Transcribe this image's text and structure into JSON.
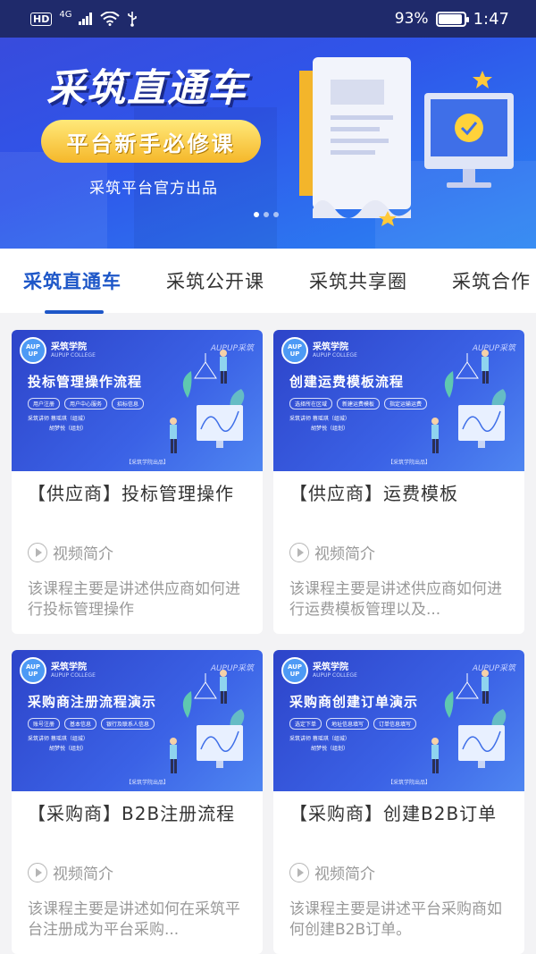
{
  "status_bar": {
    "network_left": "HD",
    "network_gen": "4G",
    "battery_percent": "93%",
    "battery_level": 0.93,
    "time": "1:47"
  },
  "banner": {
    "title": "采筑直通车",
    "subtitle": "平台新手必修课",
    "caption": "采筑平台官方出品",
    "page_count": 3,
    "active_page": 0
  },
  "tabs": [
    {
      "label": "采筑直通车",
      "active": true
    },
    {
      "label": "采筑公开课",
      "active": false
    },
    {
      "label": "采筑共享圈",
      "active": false
    },
    {
      "label": "采筑合作",
      "active": false
    }
  ],
  "thumb_common": {
    "logo": "AUP UP",
    "logo_cn": "采筑学院",
    "logo_en": "AUPUP COLLEGE",
    "brand": "AUPUP采筑",
    "lecturer": "采筑讲师  蔡瑶琪（组城）",
    "lecturer2": "胡梦悦（组划）",
    "footer": "【采筑学院出品】"
  },
  "cards": [
    {
      "thumb_title": "投标管理操作流程",
      "thumb_tags": [
        "用户注册",
        "用户中心服务",
        "招标信息"
      ],
      "title": "【供应商】投标管理操作",
      "meta": "视频简介",
      "desc": "该课程主要是讲述供应商如何进行投标管理操作"
    },
    {
      "thumb_title": "创建运费模板流程",
      "thumb_tags": [
        "选择所在区域",
        "新建运费模板",
        "指定运输运费"
      ],
      "title": "【供应商】运费模板",
      "meta": "视频简介",
      "desc": "该课程主要是讲述供应商如何进行运费模板管理以及..."
    },
    {
      "thumb_title": "采购商注册流程演示",
      "thumb_tags": [
        "账号注册",
        "基本信息",
        "银行及联系人信息"
      ],
      "title": "【采购商】B2B注册流程",
      "meta": "视频简介",
      "desc": "该课程主要是讲述如何在采筑平台注册成为平台采购..."
    },
    {
      "thumb_title": "采购商创建订单演示",
      "thumb_tags": [
        "选定下单",
        "地址信息填写",
        "订单信息填写"
      ],
      "title": "【采购商】创建B2B订单",
      "meta": "视频简介",
      "desc": "该课程主要是讲述平台采购商如何创建B2B订单。"
    }
  ]
}
